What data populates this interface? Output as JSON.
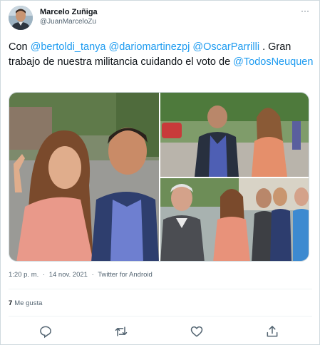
{
  "tweet": {
    "author": {
      "display_name": "Marcelo Zuñiga",
      "handle": "@JuanMarceloZu",
      "avatar_icon": "user-avatar"
    },
    "more_label": "···",
    "text": {
      "intro": "Con ",
      "mentions_line": [
        "@bertoldi_tanya",
        "@dariomartinezpj",
        "@OscarParrilli"
      ],
      "after_mentions": " . Gran trabajo de nuestra militancia cuidando el voto de ",
      "last_mention": "@TodosNeuquen"
    },
    "media": {
      "photo_count": 3
    },
    "meta": {
      "time": "1:20 p. m.",
      "separator": "·",
      "date": "14 nov. 2021",
      "source": "Twitter for Android"
    },
    "stats": {
      "likes_count": "7",
      "likes_label": "Me gusta"
    },
    "actions": [
      {
        "name": "reply",
        "icon": "reply-icon"
      },
      {
        "name": "retweet",
        "icon": "retweet-icon"
      },
      {
        "name": "like",
        "icon": "heart-icon"
      },
      {
        "name": "share",
        "icon": "share-icon"
      }
    ],
    "colors": {
      "link": "#1d9bf0",
      "text": "#0f1419",
      "secondary": "#536471",
      "border": "#cfd9de"
    }
  }
}
